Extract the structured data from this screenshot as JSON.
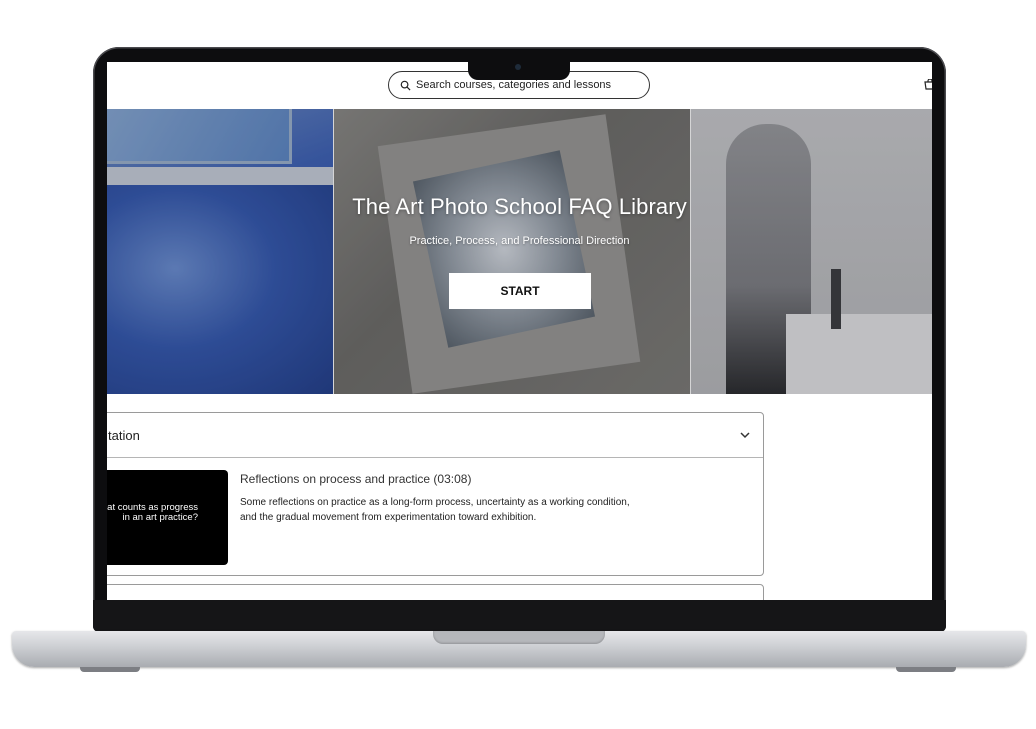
{
  "search": {
    "placeholder": "Search courses, categories and lessons"
  },
  "hero": {
    "title": "The Art Photo School FAQ Library",
    "subtitle": "Practice, Process, and Professional Direction",
    "start_label": "START"
  },
  "accordion": {
    "section_title": "tation",
    "lesson": {
      "thumbnail_text": "at counts as progress\nin an art practice?",
      "title": "Reflections on process and practice (03:08)",
      "description": "Some reflections on practice as a long-form process, uncertainty as a working condition,\nand the gradual movement from experimentation toward exhibition."
    }
  },
  "icons": {
    "search": "search-icon",
    "cart": "cart-icon",
    "chevron": "chevron-down-icon"
  }
}
